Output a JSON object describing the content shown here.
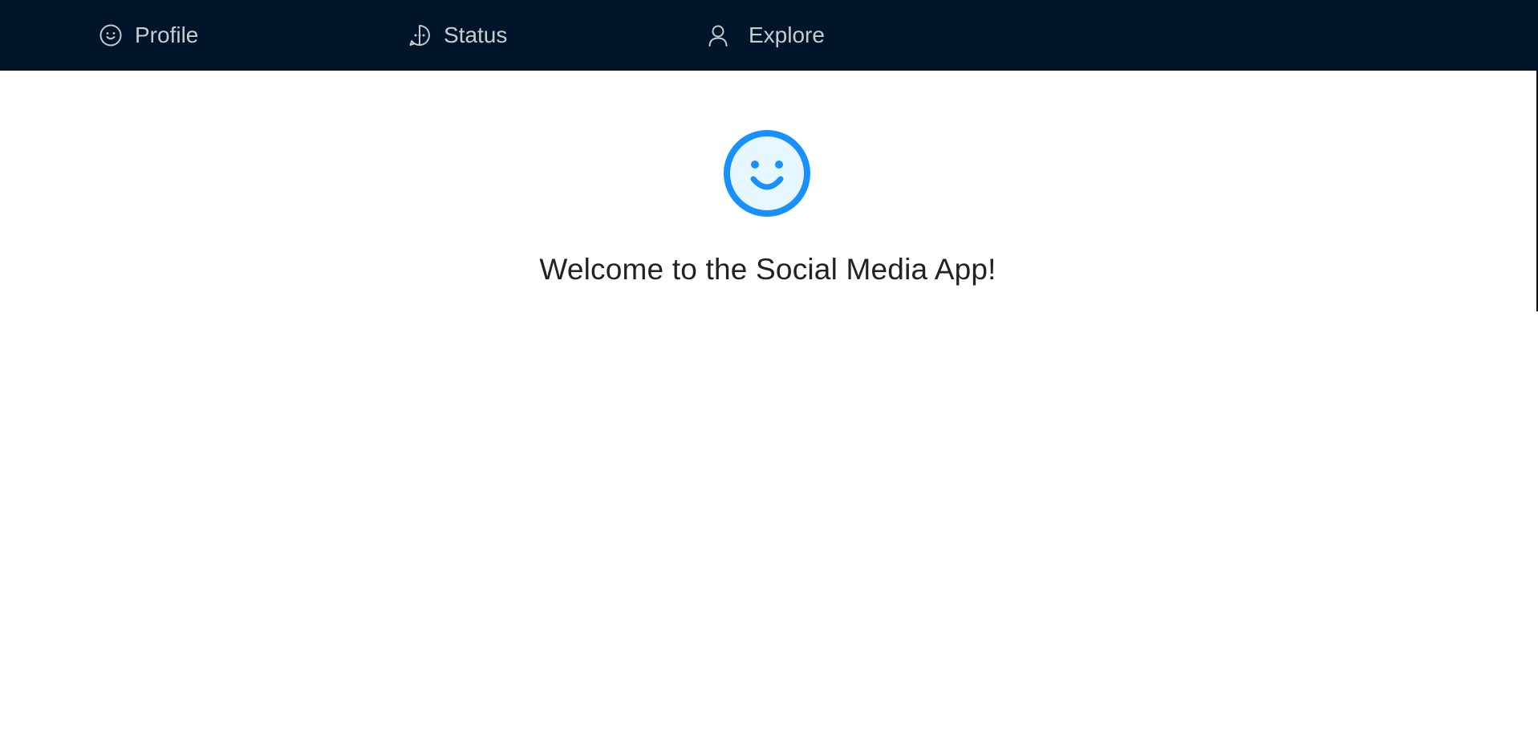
{
  "nav": {
    "items": [
      {
        "label": "Profile",
        "icon": "smile-icon"
      },
      {
        "label": "Status",
        "icon": "message-icon"
      },
      {
        "label": "Explore",
        "icon": "user-icon"
      }
    ]
  },
  "main": {
    "hero_icon": "smile-icon",
    "welcome_text": "Welcome to the Social Media App!"
  },
  "colors": {
    "nav_background": "#001529",
    "nav_text": "#c5c8cc",
    "accent": "#1890ff",
    "accent_fill": "#e6f7ff",
    "text": "#222222"
  }
}
